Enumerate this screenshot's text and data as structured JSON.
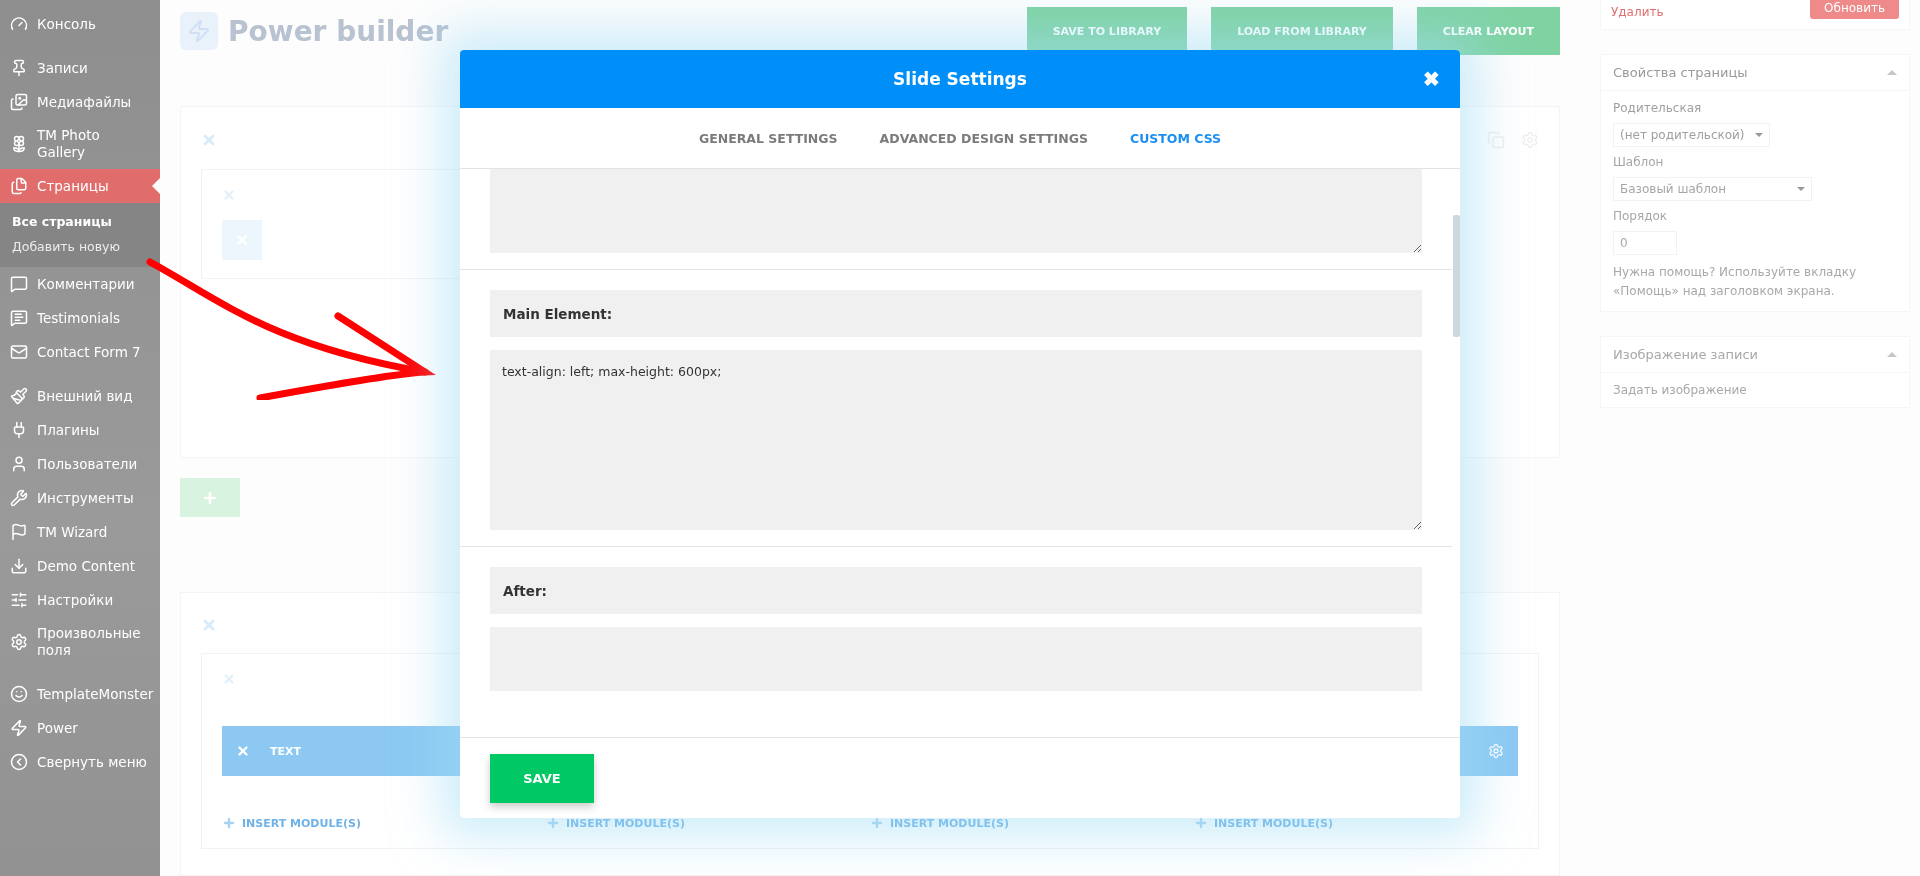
{
  "sidebar": {
    "groups": [
      {
        "items": [
          {
            "label": "Консоль",
            "selected": false
          }
        ]
      },
      {
        "items": [
          {
            "label": "Записи",
            "selected": false
          },
          {
            "label": "Медиафайлы",
            "selected": false
          },
          {
            "label": "TM Photo Gallery",
            "selected": false
          },
          {
            "label": "Страницы",
            "selected": true,
            "children": [
              {
                "label": "Все страницы",
                "selected": true
              },
              {
                "label": "Добавить новую",
                "selected": false
              }
            ]
          },
          {
            "label": "Комментарии",
            "selected": false
          },
          {
            "label": "Testimonials",
            "selected": false
          },
          {
            "label": "Contact Form 7",
            "selected": false
          }
        ]
      },
      {
        "items": [
          {
            "label": "Внешний вид",
            "selected": false
          },
          {
            "label": "Плагины",
            "selected": false
          },
          {
            "label": "Пользователи",
            "selected": false
          },
          {
            "label": "Инструменты",
            "selected": false
          },
          {
            "label": "TM Wizard",
            "selected": false
          },
          {
            "label": "Demo Content",
            "selected": false
          },
          {
            "label": "Настройки",
            "selected": false
          },
          {
            "label": "Произвольные поля",
            "selected": false
          }
        ]
      },
      {
        "items": [
          {
            "label": "TemplateMonster",
            "selected": false
          },
          {
            "label": "Power",
            "selected": false
          },
          {
            "label": "Свернуть меню",
            "selected": false
          }
        ]
      }
    ]
  },
  "builder": {
    "title": "Power builder",
    "buttons": [
      "SAVE TO LIBRARY",
      "LOAD FROM LIBRARY",
      "CLEAR LAYOUT"
    ],
    "module_label": "TEXT",
    "insert_links": [
      "INSERT MODULE(S)",
      "INSERT MODULE(S)",
      "INSERT MODULE(S)",
      "INSERT MODULE(S)"
    ]
  },
  "publish": {
    "delete_link": "Удалить",
    "update_button": "Обновить"
  },
  "page_attributes": {
    "title": "Свойства страницы",
    "parent_label": "Родительская",
    "parent_value": "(нет родительской)",
    "template_label": "Шаблон",
    "template_value": "Базовый шаблон",
    "order_label": "Порядок",
    "order_value": "0",
    "help": "Нужна помощь? Используйте вкладку «Помощь» над заголовком экрана."
  },
  "featured_image": {
    "title": "Изображение записи",
    "link": "Задать изображение"
  },
  "modal": {
    "title": "Slide Settings",
    "close": "✖",
    "tabs": [
      {
        "label": "GENERAL SETTINGS",
        "selected": false
      },
      {
        "label": "ADVANCED DESIGN SETTINGS",
        "selected": false
      },
      {
        "label": "CUSTOM CSS",
        "selected": true
      }
    ],
    "sections": [
      {
        "label": "Main Element:",
        "value": "text-align: left; max-height: 600px;"
      },
      {
        "label": "After:"
      }
    ],
    "save": "SAVE"
  }
}
